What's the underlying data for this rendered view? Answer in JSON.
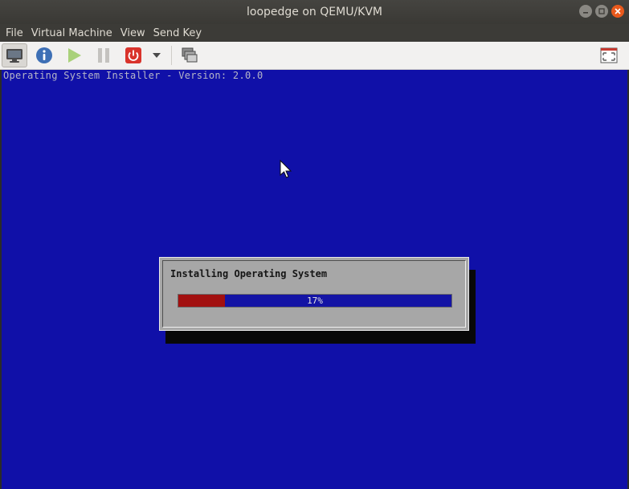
{
  "window": {
    "title": "loopedge on QEMU/KVM",
    "controls": {
      "minimize_icon": "minimize-icon",
      "maximize_icon": "maximize-icon",
      "close_icon": "close-icon"
    }
  },
  "menubar": {
    "items": [
      "File",
      "Virtual Machine",
      "View",
      "Send Key"
    ]
  },
  "toolbar": {
    "buttons": [
      {
        "name": "show-console-button",
        "icon": "monitor-icon",
        "active": true
      },
      {
        "name": "show-details-button",
        "icon": "info-icon"
      },
      {
        "name": "run-button",
        "icon": "play-icon"
      },
      {
        "name": "pause-button",
        "icon": "pause-icon"
      },
      {
        "name": "shutdown-button",
        "icon": "power-icon"
      },
      {
        "name": "shutdown-menu-button",
        "icon": "chevron-down-icon"
      },
      {
        "name": "snapshots-button",
        "icon": "snapshot-icon"
      },
      {
        "name": "fullscreen-button",
        "icon": "fullscreen-icon"
      }
    ]
  },
  "console": {
    "header": "Operating System Installer - Version: 2.0.0",
    "background": "#1010a8"
  },
  "dialog": {
    "title": "Installing Operating System",
    "progress_fraction": 0.17,
    "progress_label": "17%",
    "progress_fill_color": "#a21010",
    "progress_bg_color": "#1414a5"
  }
}
